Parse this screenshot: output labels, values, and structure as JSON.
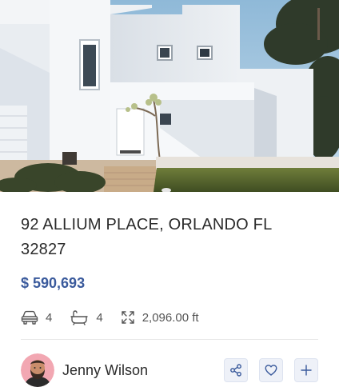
{
  "listing": {
    "address": "92 ALLIUM PLACE, ORLANDO FL 32827",
    "price": "$ 590,693",
    "features": {
      "cars": "4",
      "baths": "4",
      "area": "2,096.00 ft"
    },
    "icons": {
      "cars": "car-icon",
      "baths": "bathtub-icon",
      "area": "expand-arrows-icon"
    }
  },
  "agent": {
    "name": "Jenny Wilson"
  },
  "actions": [
    {
      "icon": "share-icon"
    },
    {
      "icon": "heart-icon"
    },
    {
      "icon": "plus-icon"
    }
  ],
  "colors": {
    "price": "#3a5a9c",
    "action_bg": "#eef1f8",
    "action_icon": "#3a5a9c"
  }
}
